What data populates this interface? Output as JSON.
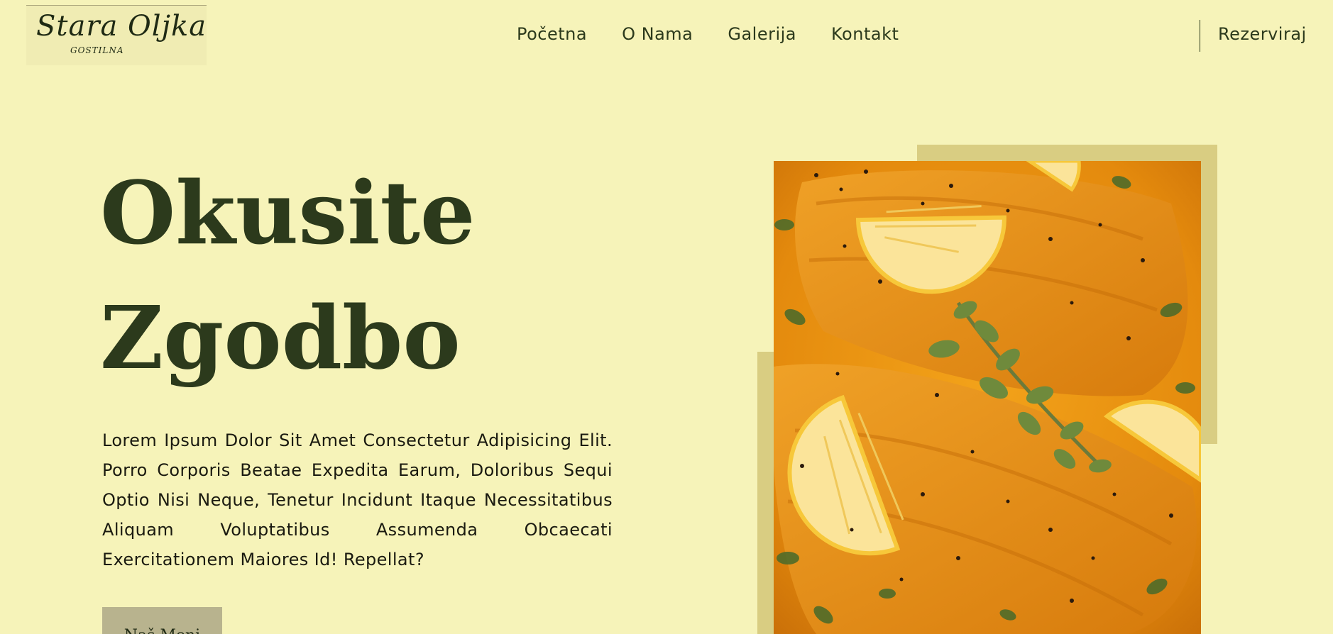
{
  "header": {
    "logo": {
      "name": "Stara Oljka",
      "subtitle": "GOSTILNA"
    },
    "nav": [
      {
        "label": "Početna"
      },
      {
        "label": "O Nama"
      },
      {
        "label": "Galerija"
      },
      {
        "label": "Kontakt"
      }
    ],
    "reserve_label": "Rezerviraj"
  },
  "hero": {
    "title_line1": "Okusite",
    "title_line2": "Zgodbo",
    "text": "Lorem Ipsum Dolor Sit Amet Consectetur Adipisicing Elit. Porro Corporis Beatae Expedita Earum, Doloribus Sequi Optio Nisi Neque, Tenetur Incidunt Itaque Necessitatibus Aliquam Voluptatibus Assumenda Obcaecati Exercitationem Maiores Id! Repellat?",
    "button_label": "Naš Meni"
  },
  "colors": {
    "background": "#f6f3b9",
    "text_dark_green": "#2c3a1c",
    "frame_accent": "#d9cd82",
    "button_bg": "#b8b38e"
  }
}
